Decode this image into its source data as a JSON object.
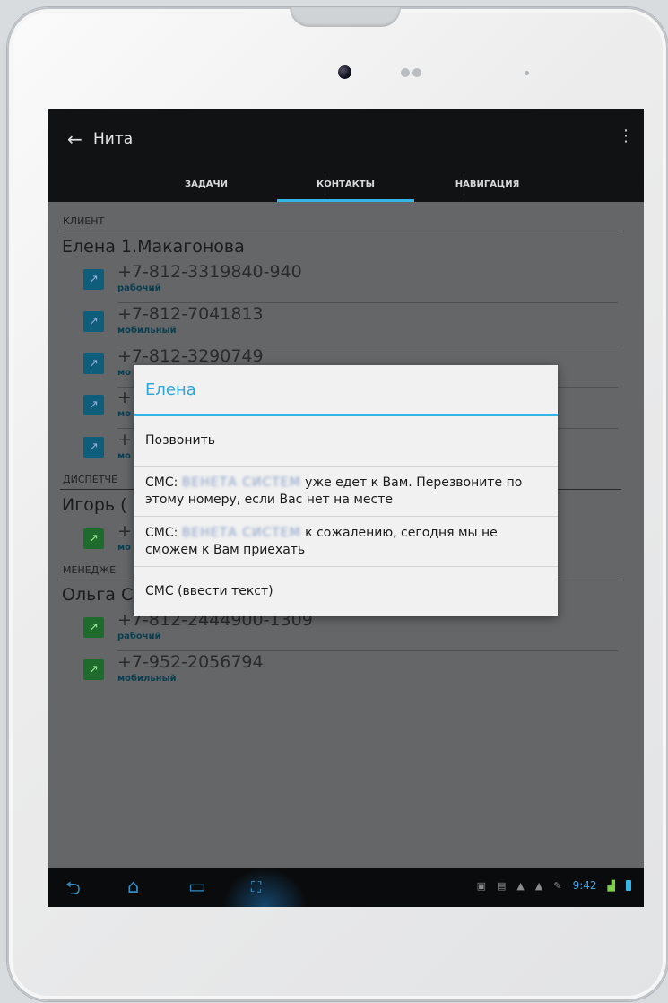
{
  "app": {
    "title": "Нита",
    "back_icon": "arrow-left-icon",
    "menu_icon": "overflow-menu-icon"
  },
  "tabs": [
    {
      "label": "ЗАДАЧИ",
      "active": false
    },
    {
      "label": "КОНТАКТЫ",
      "active": true
    },
    {
      "label": "НАВИГАЦИЯ",
      "active": false
    }
  ],
  "contacts": {
    "client": {
      "section": "КЛИЕНТ",
      "name": "Елена 1.Макагонова",
      "phones": [
        {
          "number": "+7-812-3319840-940",
          "type": "рабочий"
        },
        {
          "number": "+7-812-7041813",
          "type": "мобильный"
        },
        {
          "number": "+7-812-3290749",
          "type": "мо"
        },
        {
          "number": "+",
          "type": "мо"
        },
        {
          "number": "+",
          "type": "мо"
        }
      ]
    },
    "dispatcher": {
      "section": "ДИСПЕТЧЕ",
      "name": "Игорь (",
      "phones": [
        {
          "number": "+",
          "type": "мо"
        }
      ]
    },
    "manager": {
      "section": "МЕНЕДЖЕ",
      "name": "Ольга С",
      "phones": [
        {
          "number": "+7-812-2444900-1309",
          "type": "рабочий"
        },
        {
          "number": "+7-952-2056794",
          "type": "мобильный"
        }
      ]
    }
  },
  "dialog": {
    "title": "Елена",
    "options": [
      {
        "label": "Позвонить"
      },
      {
        "prefix": "СМС:",
        "redacted": "ВЕНЕТА СИСТЕМ",
        "text": "уже едет к Вам. Перезвоните по этому номеру, если Вас нет на месте"
      },
      {
        "prefix": "СМС:",
        "redacted": "ВЕНЕТА СИСТЕМ",
        "text": "к сожалению, сегодня мы не сможем к Вам приехать"
      },
      {
        "label": "СМС (ввести текст)"
      }
    ]
  },
  "status_bar": {
    "time": "9:42"
  },
  "colors": {
    "accent": "#33b5e5",
    "action_bar": "#111214",
    "dialog_bg": "#f1f1f1"
  }
}
